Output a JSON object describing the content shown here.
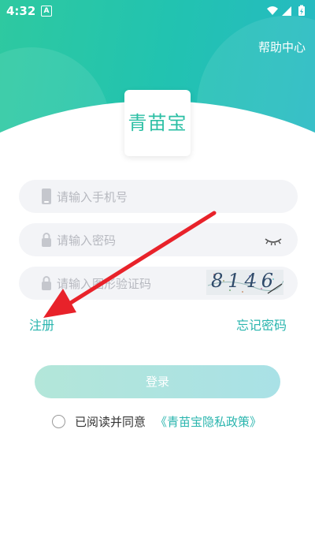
{
  "status_bar": {
    "time": "4:32",
    "badge": "A"
  },
  "header": {
    "help_label": "帮助中心"
  },
  "logo": {
    "text": "青苗宝"
  },
  "form": {
    "phone_placeholder": "请输入手机号",
    "password_placeholder": "请输入密码",
    "captcha_placeholder": "请输入图形验证码",
    "captcha_text": "8146"
  },
  "links": {
    "register": "注册",
    "forgot_password": "忘记密码"
  },
  "login_button": "登录",
  "agreement": {
    "text": "已阅读并同意",
    "policy_link": "《青苗宝隐私政策》",
    "checked": false
  },
  "colors": {
    "accent": "#2ab5ae",
    "header_start": "#2ec9a0",
    "header_end": "#26b9c4",
    "arrow": "#e8222a"
  }
}
